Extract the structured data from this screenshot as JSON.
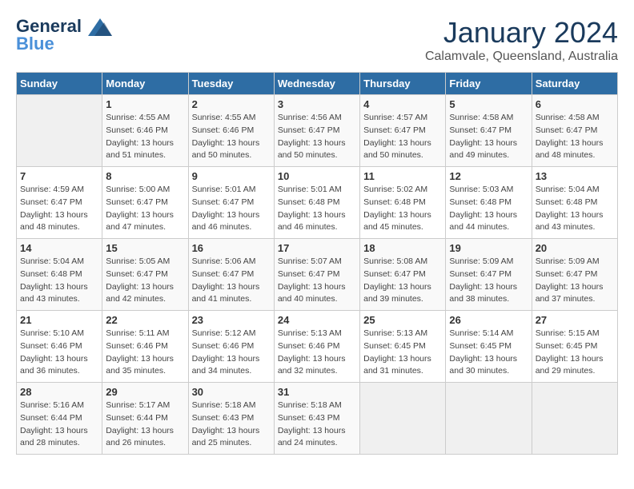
{
  "logo": {
    "line1": "General",
    "line2": "Blue"
  },
  "title": "January 2024",
  "subtitle": "Calamvale, Queensland, Australia",
  "headers": [
    "Sunday",
    "Monday",
    "Tuesday",
    "Wednesday",
    "Thursday",
    "Friday",
    "Saturday"
  ],
  "weeks": [
    [
      {
        "day": "",
        "info": ""
      },
      {
        "day": "1",
        "info": "Sunrise: 4:55 AM\nSunset: 6:46 PM\nDaylight: 13 hours\nand 51 minutes."
      },
      {
        "day": "2",
        "info": "Sunrise: 4:55 AM\nSunset: 6:46 PM\nDaylight: 13 hours\nand 50 minutes."
      },
      {
        "day": "3",
        "info": "Sunrise: 4:56 AM\nSunset: 6:47 PM\nDaylight: 13 hours\nand 50 minutes."
      },
      {
        "day": "4",
        "info": "Sunrise: 4:57 AM\nSunset: 6:47 PM\nDaylight: 13 hours\nand 50 minutes."
      },
      {
        "day": "5",
        "info": "Sunrise: 4:58 AM\nSunset: 6:47 PM\nDaylight: 13 hours\nand 49 minutes."
      },
      {
        "day": "6",
        "info": "Sunrise: 4:58 AM\nSunset: 6:47 PM\nDaylight: 13 hours\nand 48 minutes."
      }
    ],
    [
      {
        "day": "7",
        "info": "Sunrise: 4:59 AM\nSunset: 6:47 PM\nDaylight: 13 hours\nand 48 minutes."
      },
      {
        "day": "8",
        "info": "Sunrise: 5:00 AM\nSunset: 6:47 PM\nDaylight: 13 hours\nand 47 minutes."
      },
      {
        "day": "9",
        "info": "Sunrise: 5:01 AM\nSunset: 6:47 PM\nDaylight: 13 hours\nand 46 minutes."
      },
      {
        "day": "10",
        "info": "Sunrise: 5:01 AM\nSunset: 6:48 PM\nDaylight: 13 hours\nand 46 minutes."
      },
      {
        "day": "11",
        "info": "Sunrise: 5:02 AM\nSunset: 6:48 PM\nDaylight: 13 hours\nand 45 minutes."
      },
      {
        "day": "12",
        "info": "Sunrise: 5:03 AM\nSunset: 6:48 PM\nDaylight: 13 hours\nand 44 minutes."
      },
      {
        "day": "13",
        "info": "Sunrise: 5:04 AM\nSunset: 6:48 PM\nDaylight: 13 hours\nand 43 minutes."
      }
    ],
    [
      {
        "day": "14",
        "info": "Sunrise: 5:04 AM\nSunset: 6:48 PM\nDaylight: 13 hours\nand 43 minutes."
      },
      {
        "day": "15",
        "info": "Sunrise: 5:05 AM\nSunset: 6:47 PM\nDaylight: 13 hours\nand 42 minutes."
      },
      {
        "day": "16",
        "info": "Sunrise: 5:06 AM\nSunset: 6:47 PM\nDaylight: 13 hours\nand 41 minutes."
      },
      {
        "day": "17",
        "info": "Sunrise: 5:07 AM\nSunset: 6:47 PM\nDaylight: 13 hours\nand 40 minutes."
      },
      {
        "day": "18",
        "info": "Sunrise: 5:08 AM\nSunset: 6:47 PM\nDaylight: 13 hours\nand 39 minutes."
      },
      {
        "day": "19",
        "info": "Sunrise: 5:09 AM\nSunset: 6:47 PM\nDaylight: 13 hours\nand 38 minutes."
      },
      {
        "day": "20",
        "info": "Sunrise: 5:09 AM\nSunset: 6:47 PM\nDaylight: 13 hours\nand 37 minutes."
      }
    ],
    [
      {
        "day": "21",
        "info": "Sunrise: 5:10 AM\nSunset: 6:46 PM\nDaylight: 13 hours\nand 36 minutes."
      },
      {
        "day": "22",
        "info": "Sunrise: 5:11 AM\nSunset: 6:46 PM\nDaylight: 13 hours\nand 35 minutes."
      },
      {
        "day": "23",
        "info": "Sunrise: 5:12 AM\nSunset: 6:46 PM\nDaylight: 13 hours\nand 34 minutes."
      },
      {
        "day": "24",
        "info": "Sunrise: 5:13 AM\nSunset: 6:46 PM\nDaylight: 13 hours\nand 32 minutes."
      },
      {
        "day": "25",
        "info": "Sunrise: 5:13 AM\nSunset: 6:45 PM\nDaylight: 13 hours\nand 31 minutes."
      },
      {
        "day": "26",
        "info": "Sunrise: 5:14 AM\nSunset: 6:45 PM\nDaylight: 13 hours\nand 30 minutes."
      },
      {
        "day": "27",
        "info": "Sunrise: 5:15 AM\nSunset: 6:45 PM\nDaylight: 13 hours\nand 29 minutes."
      }
    ],
    [
      {
        "day": "28",
        "info": "Sunrise: 5:16 AM\nSunset: 6:44 PM\nDaylight: 13 hours\nand 28 minutes."
      },
      {
        "day": "29",
        "info": "Sunrise: 5:17 AM\nSunset: 6:44 PM\nDaylight: 13 hours\nand 26 minutes."
      },
      {
        "day": "30",
        "info": "Sunrise: 5:18 AM\nSunset: 6:43 PM\nDaylight: 13 hours\nand 25 minutes."
      },
      {
        "day": "31",
        "info": "Sunrise: 5:18 AM\nSunset: 6:43 PM\nDaylight: 13 hours\nand 24 minutes."
      },
      {
        "day": "",
        "info": ""
      },
      {
        "day": "",
        "info": ""
      },
      {
        "day": "",
        "info": ""
      }
    ]
  ]
}
